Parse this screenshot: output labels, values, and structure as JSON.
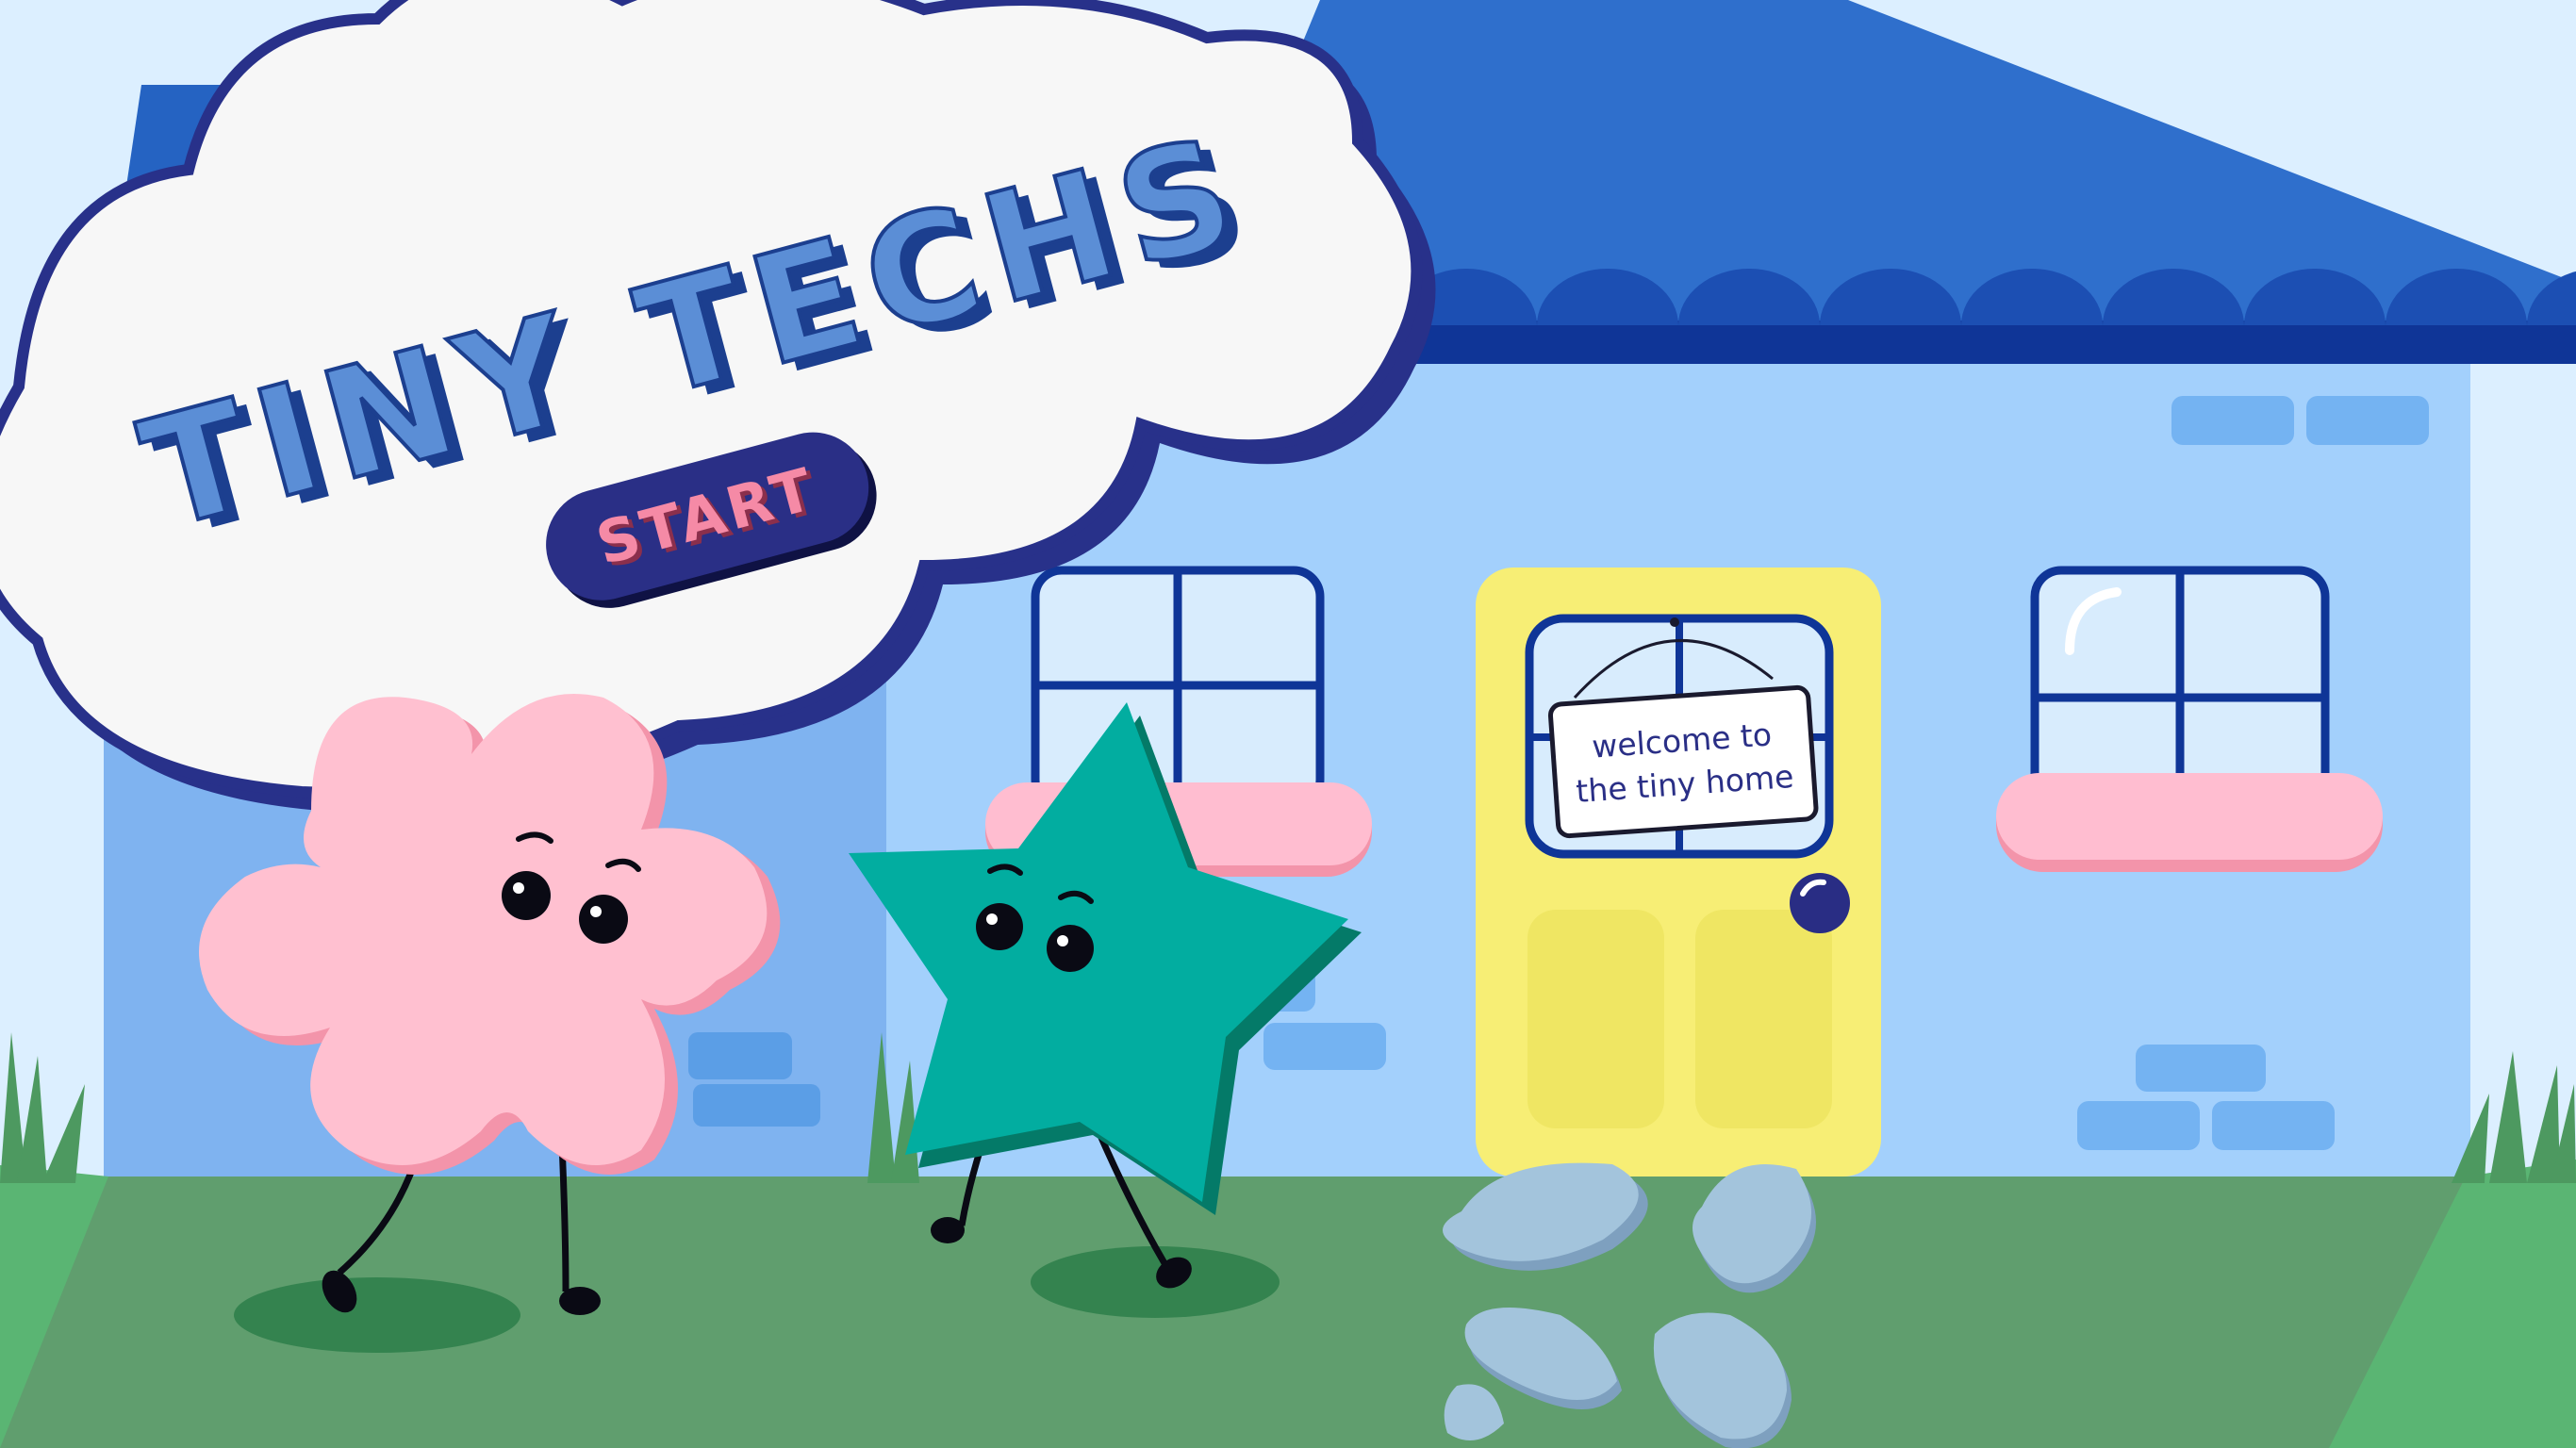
{
  "game": {
    "title": "TINY TECHS",
    "start_label": "START",
    "door_sign": {
      "line1": "welcome to",
      "line2": "the tiny home"
    }
  },
  "icons": {
    "flower_character": "pink-flower-character",
    "star_character": "teal-star-character",
    "cloud": "cloud-icon",
    "house": "house-icon"
  },
  "colors": {
    "sky": "#dcefff",
    "roof": "#2f6fcc",
    "roof_trim": "#1a3fa3",
    "house_wall": "#a3d0fc",
    "house_side": "#7fb3f0",
    "door": "#f7ee75",
    "grass": "#5e9e6e",
    "title_fill": "#5b8ed6",
    "title_outline": "#1c3f8f",
    "start_button": "#2a2f86",
    "start_text": "#f58aa6",
    "flower": "#ffc0d0",
    "star": "#02ada0"
  }
}
